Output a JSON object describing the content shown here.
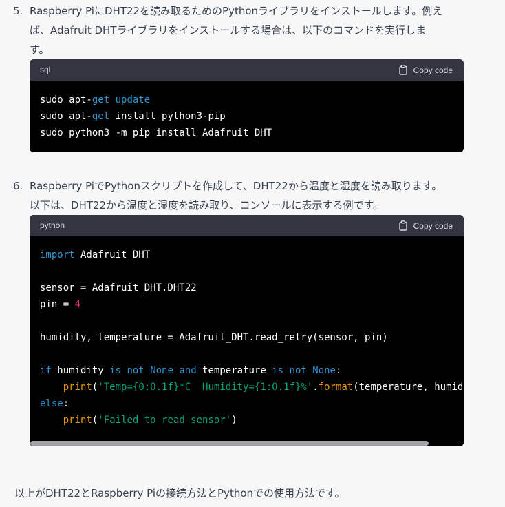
{
  "step5": {
    "number": "5.",
    "text": "Raspberry PiにDHT22を読み取るためのPythonライブラリをインストールします。例え\nば、Adafruit DHTライブラリをインストールする場合は、以下のコマンドを実行しま\nす。",
    "code": {
      "language": "sql",
      "copy_label": "Copy code",
      "lines": [
        [
          {
            "t": "sudo apt-"
          },
          {
            "t": "get",
            "c": "kw"
          },
          {
            "t": " "
          },
          {
            "t": "update",
            "c": "kw"
          }
        ],
        [
          {
            "t": "sudo apt-"
          },
          {
            "t": "get",
            "c": "kw"
          },
          {
            "t": " install python3-pip"
          }
        ],
        [
          {
            "t": "sudo python3 -m pip install Adafruit_DHT"
          }
        ]
      ]
    }
  },
  "step6": {
    "number": "6.",
    "text": "Raspberry PiでPythonスクリプトを作成して、DHT22から温度と湿度を読み取ります。\n以下は、DHT22から温度と湿度を読み取り、コンソールに表示する例です。",
    "code": {
      "language": "python",
      "copy_label": "Copy code",
      "scroll_position": 0.92,
      "lines": [
        [
          {
            "t": "import",
            "c": "kw"
          },
          {
            "t": " Adafruit_DHT"
          }
        ],
        [],
        [
          {
            "t": "sensor = Adafruit_DHT.DHT22"
          }
        ],
        [
          {
            "t": "pin = "
          },
          {
            "t": "4",
            "c": "num"
          }
        ],
        [],
        [
          {
            "t": "humidity, temperature = Adafruit_DHT.read_retry(sensor, pin)"
          }
        ],
        [],
        [
          {
            "t": "if",
            "c": "kw"
          },
          {
            "t": " humidity "
          },
          {
            "t": "is",
            "c": "kw"
          },
          {
            "t": " "
          },
          {
            "t": "not",
            "c": "kw"
          },
          {
            "t": " "
          },
          {
            "t": "None",
            "c": "kw"
          },
          {
            "t": " "
          },
          {
            "t": "and",
            "c": "kw"
          },
          {
            "t": " temperature "
          },
          {
            "t": "is",
            "c": "kw"
          },
          {
            "t": " "
          },
          {
            "t": "not",
            "c": "kw"
          },
          {
            "t": " "
          },
          {
            "t": "None",
            "c": "kw"
          },
          {
            "t": ":"
          }
        ],
        [
          {
            "t": "    "
          },
          {
            "t": "print",
            "c": "call"
          },
          {
            "t": "("
          },
          {
            "t": "'Temp={0:0.1f}*C  Humidity={1:0.1f}%'",
            "c": "str"
          },
          {
            "t": "."
          },
          {
            "t": "format",
            "c": "call"
          },
          {
            "t": "(temperature, humidity))"
          }
        ],
        [
          {
            "t": "else",
            "c": "kw"
          },
          {
            "t": ":"
          }
        ],
        [
          {
            "t": "    "
          },
          {
            "t": "print",
            "c": "call"
          },
          {
            "t": "("
          },
          {
            "t": "'Failed to read sensor'",
            "c": "str"
          },
          {
            "t": ")"
          }
        ]
      ]
    }
  },
  "footer": {
    "text": "以上がDHT22とRaspberry Piの接続方法とPythonでの使用方法です。"
  }
}
